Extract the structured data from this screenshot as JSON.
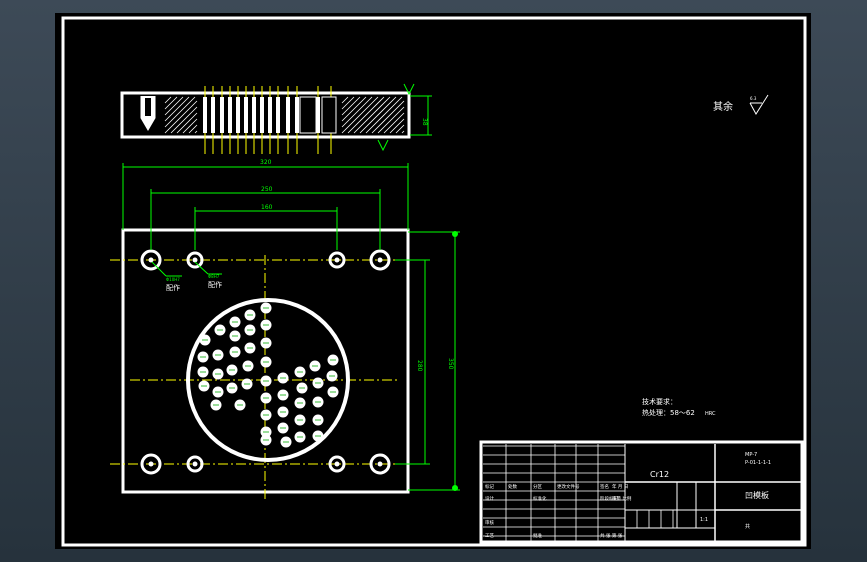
{
  "colors": {
    "background": "#000000",
    "frame": "#ffffff",
    "dimension": "#00ff00",
    "centerline": "#ffff00",
    "hatch": "#ffffff",
    "outer": "#2d3a45"
  },
  "surface_note": {
    "label": "其余",
    "roughness": "6.3"
  },
  "dimensions": {
    "overall_width": "320",
    "hole_span_outer": "250",
    "hole_span_inner": "160",
    "height_inner": "280",
    "height_outer": "350",
    "thickness": "38"
  },
  "hole_notes": [
    {
      "size": "Φ10H7",
      "label": "配作"
    },
    {
      "size": "Φ8H7",
      "label": "配作"
    }
  ],
  "tech_requirements": {
    "title": "技术要求：",
    "heat_treatment": "热处理：58～62",
    "unit": "HRC"
  },
  "title_block": {
    "material": "Cr12",
    "part_name": "凹模板",
    "code": "MP-7",
    "drawing_no": "P-01-1-1-1",
    "scale": "1:1",
    "sheet": "共",
    "rows": [
      [
        "",
        "",
        "",
        "",
        "",
        ""
      ],
      [
        "标记",
        "处数",
        "分区",
        "更改文件号",
        "签名",
        "年 月 日"
      ],
      [
        "设计",
        "",
        "标准化",
        "",
        "阶段标记",
        "重量 比例"
      ],
      [
        "审核",
        "",
        "",
        "",
        "",
        ""
      ],
      [
        "工艺",
        "",
        "批准",
        "",
        "共 张 第 张",
        ""
      ]
    ]
  }
}
